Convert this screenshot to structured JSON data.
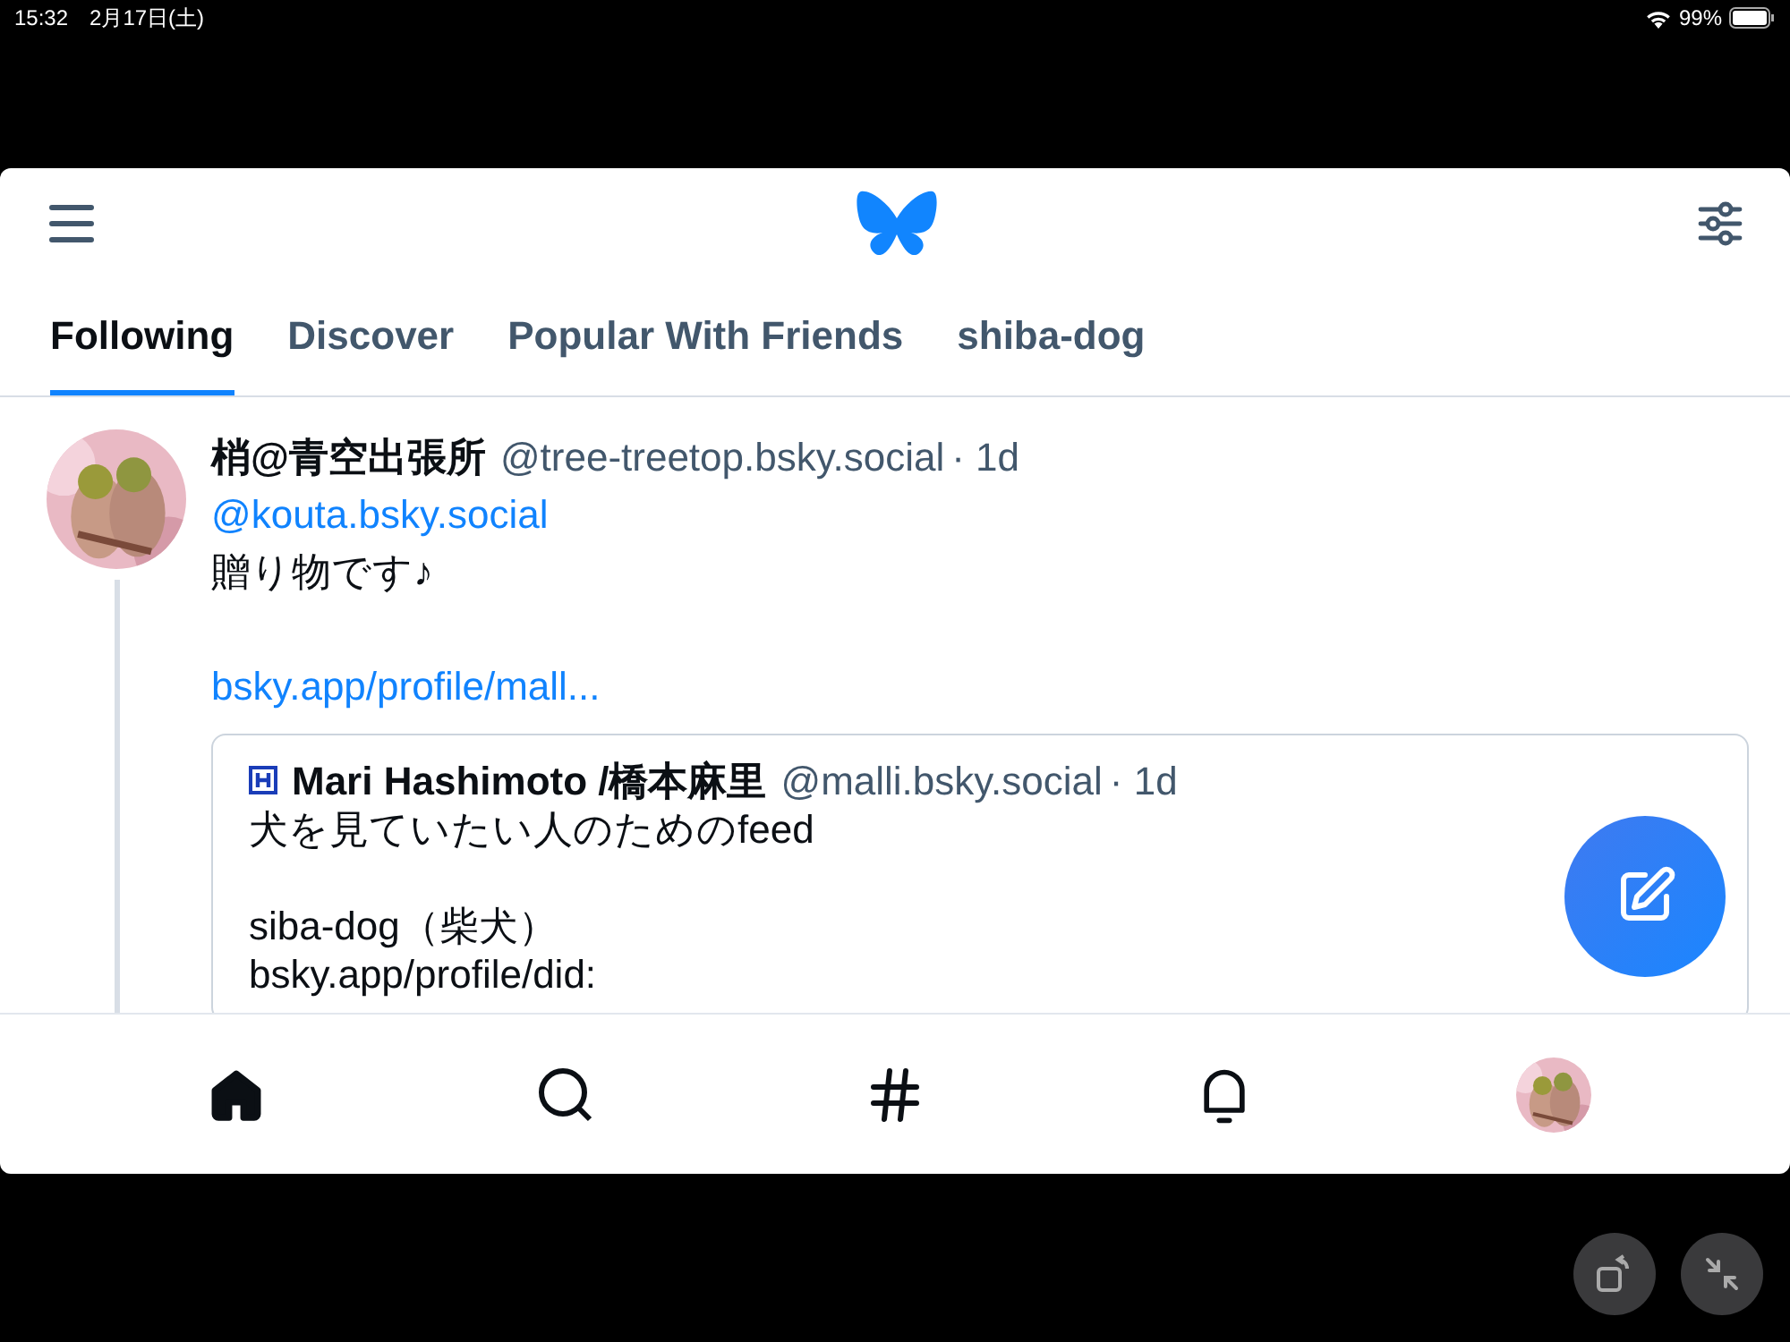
{
  "status_bar": {
    "time": "15:32",
    "date": "2月17日(土)",
    "battery": "99%"
  },
  "tabs": [
    {
      "label": "Following",
      "selected": true
    },
    {
      "label": "Discover",
      "selected": false
    },
    {
      "label": "Popular With Friends",
      "selected": false
    },
    {
      "label": "shiba-dog",
      "selected": false
    }
  ],
  "post": {
    "author": "梢@青空出張所",
    "handle": "@tree-treetop.bsky.social",
    "time": "· 1d",
    "mention": "@kouta.bsky.social",
    "text": "贈り物です♪",
    "link": "bsky.app/profile/mall...",
    "quote": {
      "author": "Mari Hashimoto /橋本麻里",
      "handle": "@malli.bsky.social",
      "time": "· 1d",
      "paragraphs": [
        [
          "犬を見ていたい人のためのfeed"
        ],
        [
          "siba-dog（柴犬）",
          "bsky.app/profile/did:"
        ]
      ]
    }
  },
  "nav": [
    {
      "kind": "home",
      "selected": true
    },
    {
      "kind": "search",
      "selected": false
    },
    {
      "kind": "feeds",
      "selected": false
    },
    {
      "kind": "notifications",
      "selected": false
    },
    {
      "kind": "profile",
      "selected": false
    }
  ]
}
